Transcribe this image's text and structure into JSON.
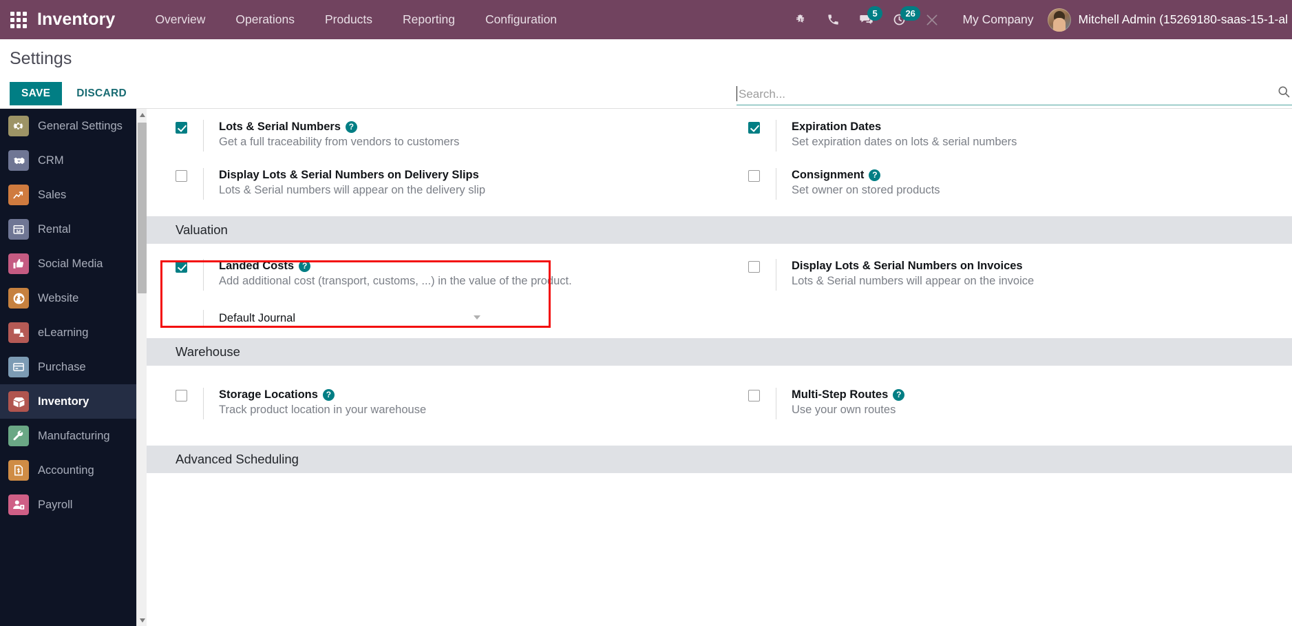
{
  "navbar": {
    "apps_icon": "apps-grid-icon",
    "brand": "Inventory",
    "menu": [
      {
        "label": "Overview"
      },
      {
        "label": "Operations"
      },
      {
        "label": "Products"
      },
      {
        "label": "Reporting"
      },
      {
        "label": "Configuration"
      }
    ],
    "sys_icons": [
      {
        "name": "bug-icon",
        "badge": ""
      },
      {
        "name": "phone-icon",
        "badge": ""
      },
      {
        "name": "chat-icon",
        "badge": "5"
      },
      {
        "name": "activity-clock-icon",
        "badge": "26"
      },
      {
        "name": "tools-icon",
        "badge": ""
      }
    ],
    "company": "My Company",
    "username": "Mitchell Admin (15269180-saas-15-1-al",
    "accent_purple": "#71435f",
    "badge_color": "#017e84"
  },
  "control_panel": {
    "title": "Settings",
    "save_label": "SAVE",
    "discard_label": "DISCARD",
    "save_color": "#017e84"
  },
  "search": {
    "placeholder": "Search...",
    "value": "",
    "icon": "search-icon"
  },
  "sidebar": {
    "items": [
      {
        "label": "General Settings",
        "icon": "gear-icon",
        "color": "#9d9466",
        "active": false
      },
      {
        "label": "CRM",
        "icon": "handshake-icon",
        "color": "#6f7694",
        "active": false
      },
      {
        "label": "Sales",
        "icon": "chart-arrow-icon",
        "color": "#cf7b3f",
        "active": false
      },
      {
        "label": "Rental",
        "icon": "calendar-icon",
        "color": "#6f7694",
        "active": false
      },
      {
        "label": "Social Media",
        "icon": "thumbs-up-icon",
        "color": "#c55b82",
        "active": false
      },
      {
        "label": "Website",
        "icon": "globe-icon",
        "color": "#c6813f",
        "active": false
      },
      {
        "label": "eLearning",
        "icon": "elearning-icon",
        "color": "#b55a55",
        "active": false
      },
      {
        "label": "Purchase",
        "icon": "card-icon",
        "color": "#7c9bb4",
        "active": false
      },
      {
        "label": "Inventory",
        "icon": "box-icon",
        "color": "#b0554f",
        "active": true
      },
      {
        "label": "Manufacturing",
        "icon": "wrench-icon",
        "color": "#6aa785",
        "active": false
      },
      {
        "label": "Accounting",
        "icon": "invoice-icon",
        "color": "#cf8c45",
        "active": false
      },
      {
        "label": "Payroll",
        "icon": "payroll-icon",
        "color": "#cf5f86",
        "active": false
      }
    ]
  },
  "settings": {
    "traceability_rows": [
      {
        "title": "Lots & Serial Numbers",
        "desc": "Get a full traceability from vendors to customers",
        "checked": true,
        "help": true
      },
      {
        "title": "Expiration Dates",
        "desc": "Set expiration dates on lots & serial numbers",
        "checked": true,
        "help": false
      },
      {
        "title": "Display Lots & Serial Numbers on Delivery Slips",
        "desc": "Lots & Serial numbers will appear on the delivery slip",
        "checked": false,
        "help": false
      },
      {
        "title": "Consignment",
        "desc": "Set owner on stored products",
        "checked": false,
        "help": true
      }
    ],
    "valuation": {
      "heading": "Valuation",
      "rows": [
        {
          "title": "Landed Costs",
          "desc": "Add additional cost (transport, customs, ...) in the value of the product.",
          "checked": true,
          "help": true,
          "highlighted": true
        },
        {
          "title": "Display Lots & Serial Numbers on Invoices",
          "desc": "Lots & Serial numbers will appear on the invoice",
          "checked": false,
          "help": false
        }
      ],
      "default_journal": {
        "label": "Default Journal",
        "value": "",
        "placeholder": ""
      }
    },
    "warehouse": {
      "heading": "Warehouse",
      "rows": [
        {
          "title": "Storage Locations",
          "desc": "Track product location in your warehouse",
          "checked": false,
          "help": true
        },
        {
          "title": "Multi-Step Routes",
          "desc": "Use your own routes",
          "checked": false,
          "help": true
        }
      ]
    },
    "advanced_scheduling": {
      "heading": "Advanced Scheduling"
    },
    "help_glyph": "?",
    "highlight_color": "#f30d0d"
  }
}
